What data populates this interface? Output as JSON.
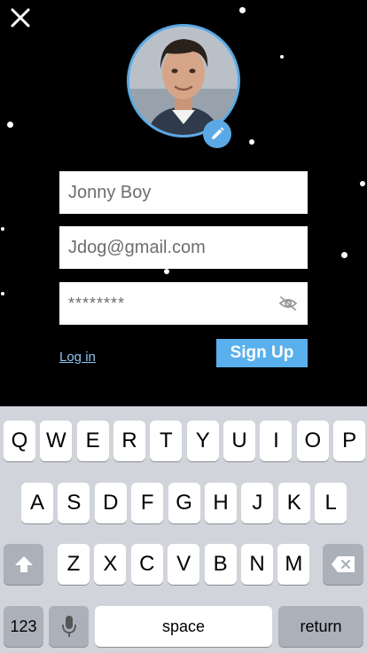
{
  "form": {
    "name_value": "Jonny Boy",
    "email_value": "Jdog@gmail.com",
    "password_value": "********",
    "login_label": "Log in",
    "signup_label": "Sign Up"
  },
  "icons": {
    "close": "close-icon",
    "edit": "pencil-icon",
    "visibility": "eye-slash-icon",
    "shift": "shift-arrow-icon",
    "delete": "backspace-icon",
    "mic": "microphone-icon"
  },
  "colors": {
    "accent": "#5ab0ec",
    "link": "#8fc4ef",
    "background": "#000000",
    "keyboard": "#d1d5db"
  },
  "keyboard": {
    "row1": [
      "Q",
      "W",
      "E",
      "R",
      "T",
      "Y",
      "U",
      "I",
      "O",
      "P"
    ],
    "row2": [
      "A",
      "S",
      "D",
      "F",
      "G",
      "H",
      "J",
      "K",
      "L"
    ],
    "row3": [
      "Z",
      "X",
      "C",
      "V",
      "B",
      "N",
      "M"
    ],
    "numbers_label": "123",
    "space_label": "space",
    "return_label": "return"
  }
}
